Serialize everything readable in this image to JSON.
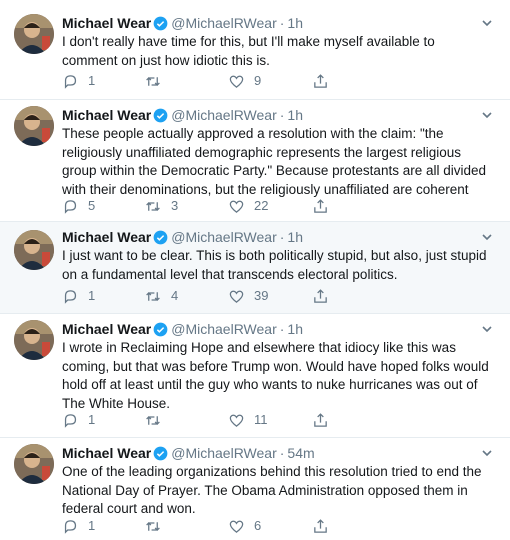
{
  "colors": {
    "accent": "#1da1f2",
    "secondary_text": "#657786",
    "highlight": "#f5f8fa"
  },
  "tweets": [
    {
      "name": "Michael Wear",
      "handle": "@MichaelRWear",
      "time": "1h",
      "text": "I don't really have time for this, but I'll make myself available to comment on just how idiotic this is.",
      "replies": "1",
      "retweets": "",
      "likes": "9"
    },
    {
      "name": "Michael Wear",
      "handle": "@MichaelRWear",
      "time": "1h",
      "text": "These people actually approved a resolution with the claim: \"the religiously unaffiliated demographic represents the largest religious group within the Democratic Party.\" Because protestants are all divided with their denominations, but the religiously unaffiliated are coherent",
      "replies": "5",
      "retweets": "3",
      "likes": "22"
    },
    {
      "name": "Michael Wear",
      "handle": "@MichaelRWear",
      "time": "1h",
      "text": "I just want to be clear. This is both politically stupid, but also, just stupid on a fundamental level that transcends electoral politics.",
      "replies": "1",
      "retweets": "4",
      "likes": "39"
    },
    {
      "name": "Michael Wear",
      "handle": "@MichaelRWear",
      "time": "1h",
      "text": "I wrote in Reclaiming Hope and elsewhere that idiocy like this was coming, but that was before Trump won. Would have hoped folks would hold off at least until the guy who wants to nuke hurricanes was out of The White House.",
      "replies": "1",
      "retweets": "",
      "likes": "11"
    },
    {
      "name": "Michael Wear",
      "handle": "@MichaelRWear",
      "time": "54m",
      "text": "One of the leading organizations behind this resolution tried to end the National Day of Prayer. The Obama Administration opposed them in federal court and won.",
      "replies": "1",
      "retweets": "",
      "likes": "6"
    }
  ]
}
